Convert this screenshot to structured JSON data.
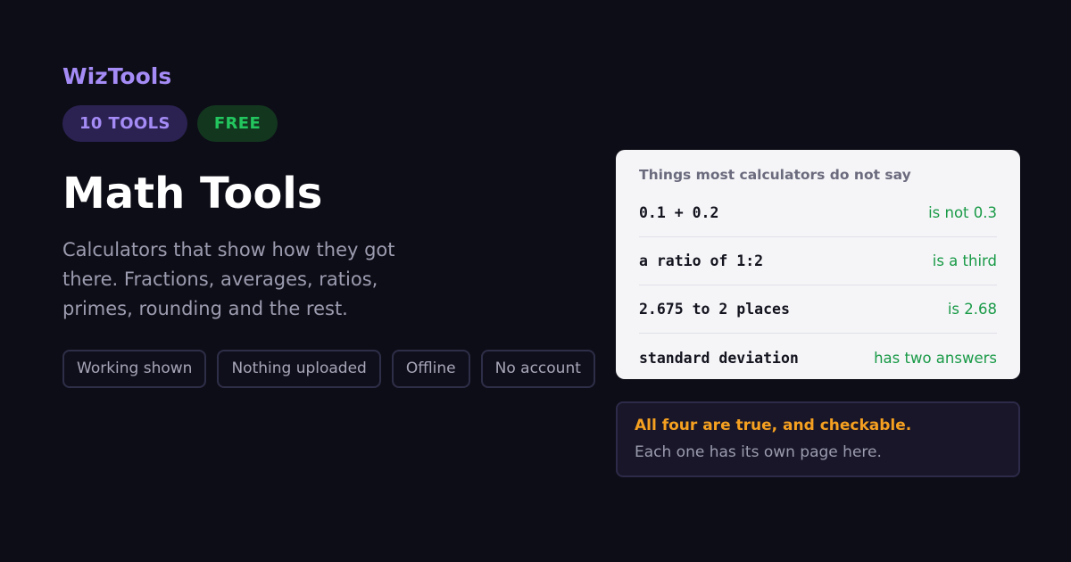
{
  "brand": "WizTools",
  "badges": {
    "tools": "10 TOOLS",
    "free": "FREE"
  },
  "hero": {
    "title": "Math Tools",
    "subtitle": "Calculators that show how they got there. Fractions, averages, ratios, primes, rounding and the rest."
  },
  "features": [
    "Working shown",
    "Nothing uploaded",
    "Offline",
    "No account"
  ],
  "facts_card": {
    "heading": "Things most calculators do not say",
    "rows": [
      {
        "claim": "0.1 + 0.2",
        "verdict": "is not 0.3"
      },
      {
        "claim": "a ratio of 1:2",
        "verdict": "is a third"
      },
      {
        "claim": "2.675 to 2 places",
        "verdict": "is 2.68"
      },
      {
        "claim": "standard deviation",
        "verdict": "has two answers"
      }
    ]
  },
  "note": {
    "title": "All four are true, and checkable.",
    "text": "Each one has its own page here."
  },
  "colors": {
    "background": "#0d0d17",
    "brand_purple": "#a48bf5",
    "free_green": "#22c55e",
    "verdict_green": "#1a9a47",
    "note_orange": "#f5a020"
  }
}
